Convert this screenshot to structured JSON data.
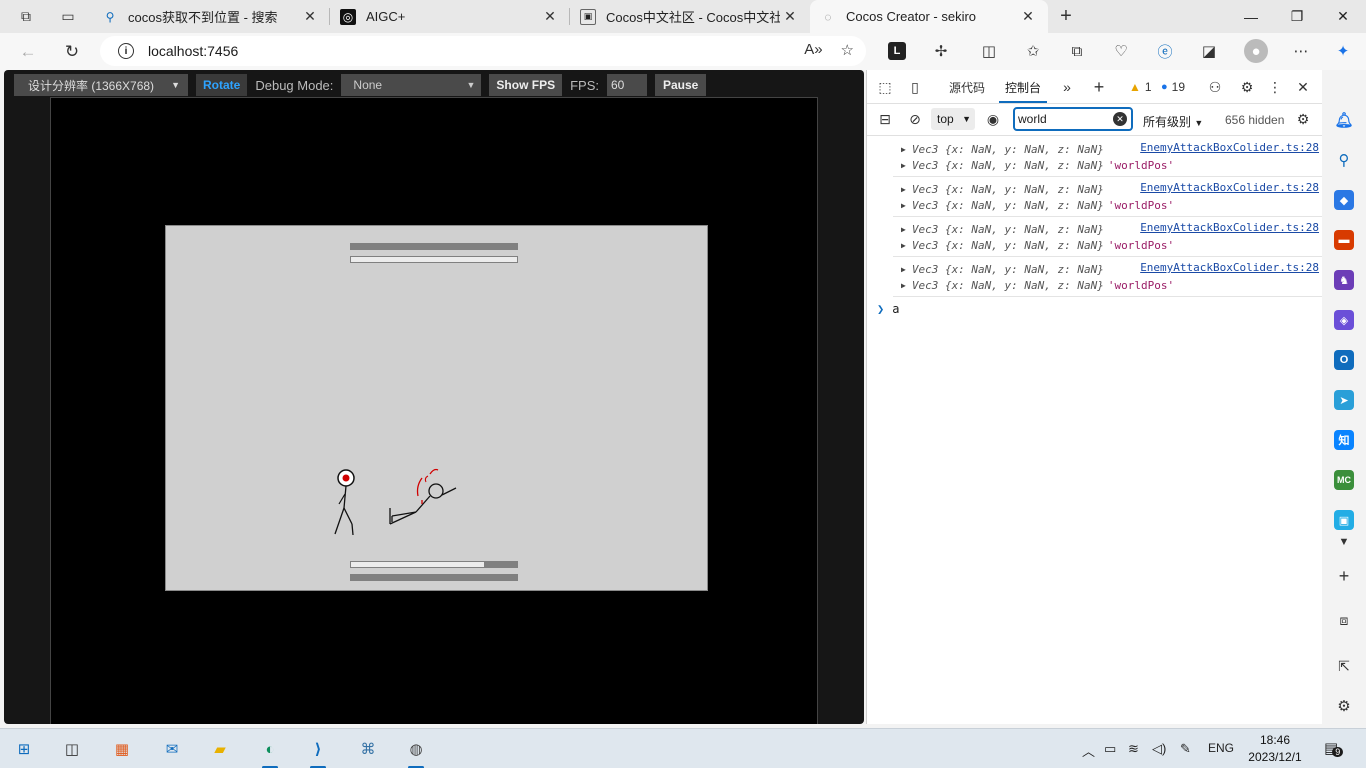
{
  "tabs": [
    {
      "title": "cocos获取不到位置 - 搜索",
      "icon": "search-icon"
    },
    {
      "title": "AIGC+",
      "icon": "aigc-icon"
    },
    {
      "title": "Cocos中文社区 - Cocos中文社区",
      "icon": "cocos-forum-icon"
    },
    {
      "title": "Cocos Creator - sekiro",
      "icon": "cocos-creator-icon",
      "active": true
    }
  ],
  "address": {
    "url": "localhost:7456"
  },
  "cocos_toolbar": {
    "resolution": "设计分辨率 (1366X768)",
    "rotate": "Rotate",
    "debug_label": "Debug Mode:",
    "debug_value": "None",
    "show_fps": "Show FPS",
    "fps_label": "FPS:",
    "fps_value": "60",
    "pause": "Pause"
  },
  "game": {
    "top_health": 1.0,
    "bottom_health": 0.8,
    "colors": {
      "bar_dark": "#808080",
      "bar_light": "#ececec",
      "scene_bg": "#d0d0d0",
      "blood": "#d00000"
    }
  },
  "devtools": {
    "tabs": [
      "源代码",
      "控制台"
    ],
    "active_tab": "控制台",
    "warnings": "1",
    "messages": "19",
    "context": "top",
    "filter": "world",
    "levels": "所有级别",
    "hidden": "656 hidden",
    "log_groups": [
      {
        "lines": [
          "Vec3 {x: NaN, y: NaN, z: NaN}",
          "Vec3 {x: NaN, y: NaN, z: NaN}"
        ],
        "tag": "'worldPos'",
        "source": "EnemyAttackBoxColider.ts:28"
      },
      {
        "lines": [
          "Vec3 {x: NaN, y: NaN, z: NaN}",
          "Vec3 {x: NaN, y: NaN, z: NaN}"
        ],
        "tag": "'worldPos'",
        "source": "EnemyAttackBoxColider.ts:28"
      },
      {
        "lines": [
          "Vec3 {x: NaN, y: NaN, z: NaN}",
          "Vec3 {x: NaN, y: NaN, z: NaN}"
        ],
        "tag": "'worldPos'",
        "source": "EnemyAttackBoxColider.ts:28"
      },
      {
        "lines": [
          "Vec3 {x: NaN, y: NaN, z: NaN}",
          "Vec3 {x: NaN, y: NaN, z: NaN}"
        ],
        "tag": "'worldPos'",
        "source": "EnemyAttackBoxColider.ts:28"
      }
    ],
    "prompt_text": "a"
  },
  "taskbar": {
    "lang": "ENG",
    "time": "18:46",
    "date": "2023/12/1",
    "notifications": "9"
  },
  "colors": {
    "accent": "#0f6cbd",
    "cocos_blue": "#2ea3ff"
  }
}
